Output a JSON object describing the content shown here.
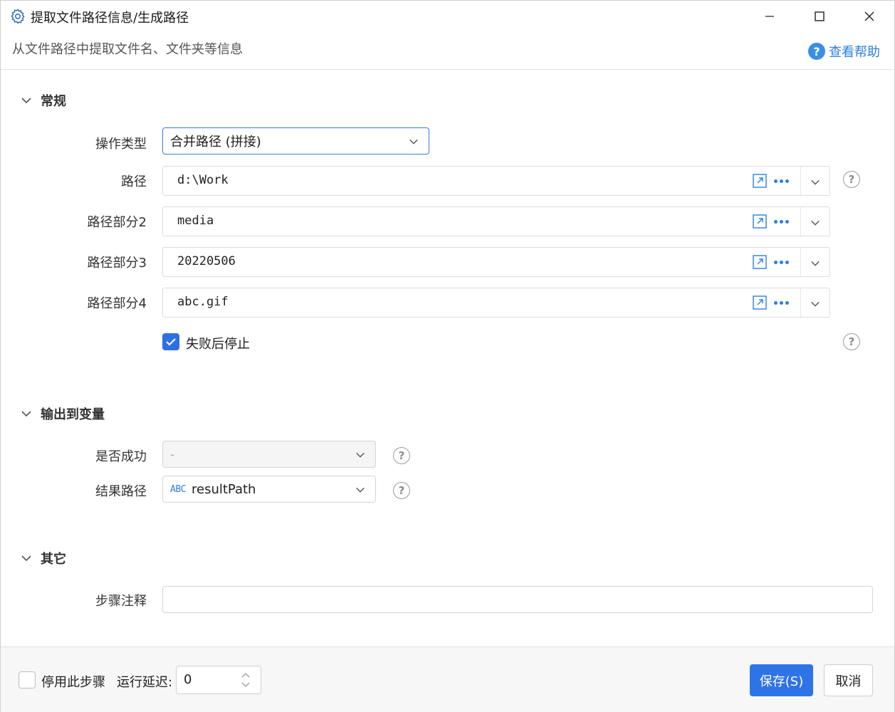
{
  "window": {
    "title": "提取文件路径信息/生成路径",
    "subtitle": "从文件路径中提取文件名、文件夹等信息",
    "help_label": "查看帮助"
  },
  "sections": {
    "general": "常规",
    "output": "输出到变量",
    "other": "其它"
  },
  "general": {
    "operation_type_label": "操作类型",
    "operation_type_value": "合并路径 (拼接)",
    "paths": [
      {
        "label": "路径",
        "value": "d:\\Work"
      },
      {
        "label": "路径部分2",
        "value": "media"
      },
      {
        "label": "路径部分3",
        "value": "20220506"
      },
      {
        "label": "路径部分4",
        "value": "abc.gif"
      }
    ],
    "stop_on_fail_label": "失败后停止",
    "stop_on_fail_checked": true
  },
  "output": {
    "success_label": "是否成功",
    "success_value": "-",
    "result_label": "结果路径",
    "result_type_badge": "ABC",
    "result_value": "resultPath"
  },
  "other": {
    "comment_label": "步骤注释",
    "comment_value": ""
  },
  "footer": {
    "disable_label": "停用此步骤",
    "disable_checked": false,
    "delay_label": "运行延迟:",
    "delay_value": "0",
    "save_label": "保存(S)",
    "cancel_label": "取消"
  },
  "colors": {
    "accent": "#2f74e6",
    "link": "#2b7fe0"
  }
}
